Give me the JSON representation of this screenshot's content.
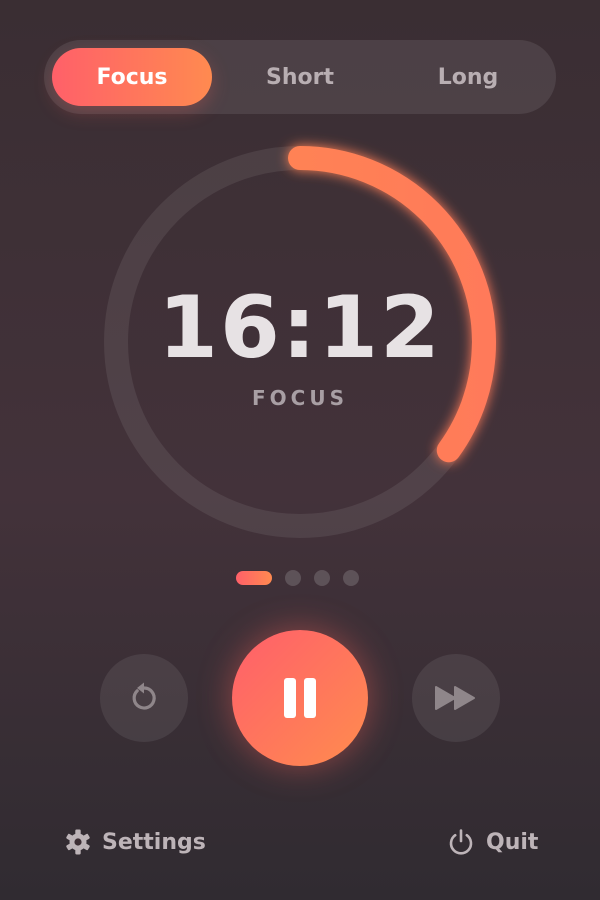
{
  "tabs": [
    {
      "label": "Focus",
      "active": true
    },
    {
      "label": "Short",
      "active": false
    },
    {
      "label": "Long",
      "active": false
    }
  ],
  "timer": {
    "time": "16:12",
    "mode": "FOCUS",
    "progress_fraction": 0.35
  },
  "sessions": {
    "total": 4,
    "current": 1
  },
  "controls": {
    "reset_icon": "restart-icon",
    "play_pause_icon": "pause-icon",
    "skip_icon": "fast-forward-icon"
  },
  "footer": {
    "settings_label": "Settings",
    "settings_icon": "gear-icon",
    "quit_label": "Quit",
    "quit_icon": "power-icon"
  },
  "colors": {
    "accent_start": "#ff6069",
    "accent_end": "#ff8a50",
    "background": "#3f3037"
  }
}
